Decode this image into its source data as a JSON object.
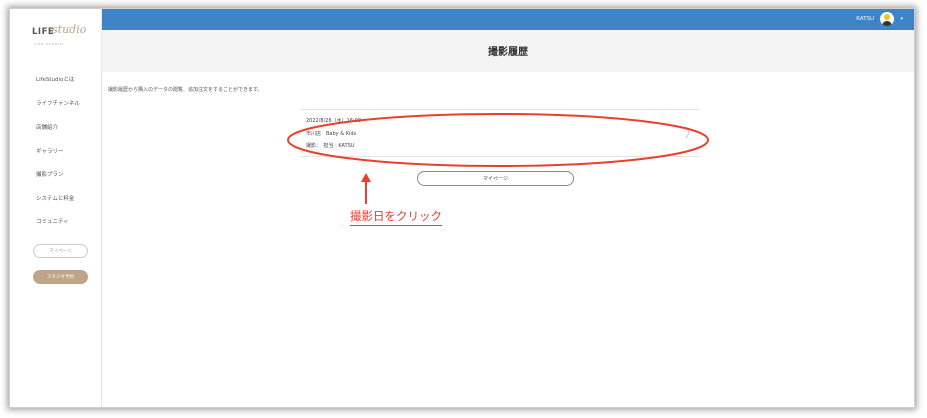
{
  "logo": {
    "brand": "LIFE",
    "script": "studio",
    "sub": "LIFE STUDIO"
  },
  "sidebar": {
    "items": [
      {
        "label": "LifeStudioとは"
      },
      {
        "label": "ライフチャンネル"
      },
      {
        "label": "店舗紹介"
      },
      {
        "label": "ギャラリー"
      },
      {
        "label": "撮影プラン"
      },
      {
        "label": "システムと料金"
      },
      {
        "label": "コミュニティ"
      }
    ],
    "mypage_label": "マイページ",
    "reserve_label": "スタジオ予約"
  },
  "header": {
    "user_name": "KATSU",
    "caret": "▾"
  },
  "page": {
    "title": "撮影履歴",
    "intro": "撮影履歴から購入のデータの閲覧、追加注文をすることができます。"
  },
  "history": {
    "date": "2022/8/26（水）16:00",
    "store": "市川店　Baby & Kids",
    "photographer": "撮影：　担当 : KATSU",
    "chevron": "〉"
  },
  "mypage_button": "マイページ",
  "annotation": {
    "text": "撮影日をクリック",
    "color": "#e8402c"
  },
  "colors": {
    "topbar": "#3e84c6",
    "reserve": "#bfa587",
    "annotation": "#e8402c"
  }
}
